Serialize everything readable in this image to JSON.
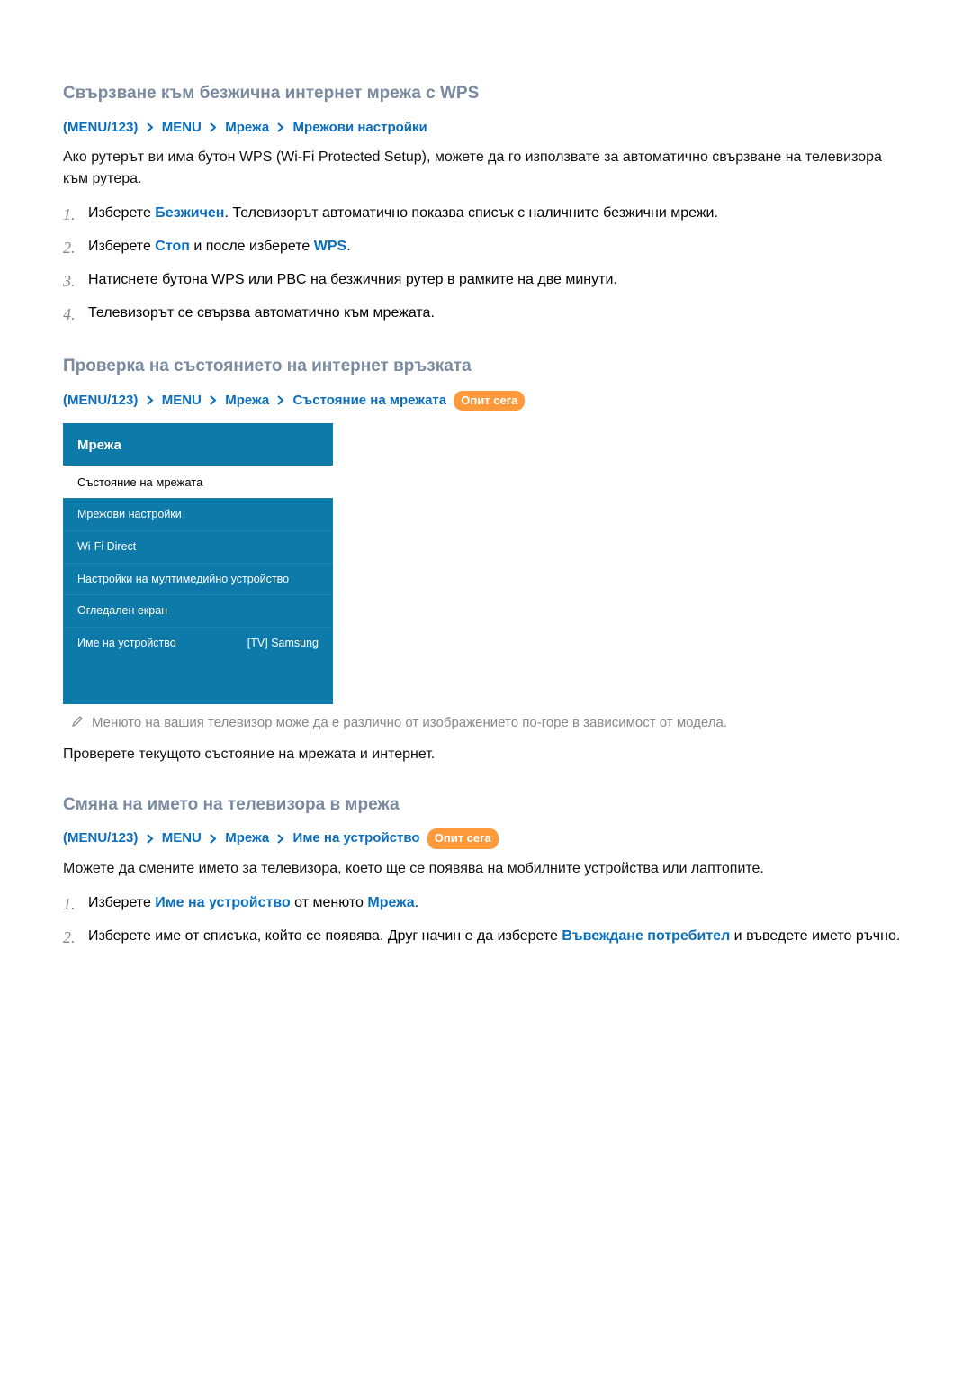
{
  "section1": {
    "title": "Свързване към безжична интернет мрежа с WPS",
    "breadcrumb": {
      "paren_open": "(",
      "p1": "MENU/123",
      "paren_close": ")",
      "p2": "MENU",
      "p3": "Мрежа",
      "p4": "Мрежови настройки"
    },
    "intro": "Ако рутерът ви има бутон WPS (Wi-Fi Protected Setup), можете да го използвате за автоматично свързване на телевизора към рутера.",
    "steps": [
      {
        "num": "1.",
        "pre": "Изберете ",
        "kw1": "Безжичен",
        "post1": ". Телевизорът автоматично показва списък с наличните безжични мрежи."
      },
      {
        "num": "2.",
        "pre": "Изберете ",
        "kw1": "Стоп",
        "mid": " и после изберете ",
        "kw2": "WPS",
        "post": "."
      },
      {
        "num": "3.",
        "text": "Натиснете бутона WPS или PBC на безжичния рутер в рамките на две минути."
      },
      {
        "num": "4.",
        "text": "Телевизорът се свързва автоматично към мрежата."
      }
    ]
  },
  "section2": {
    "title": "Проверка на състоянието на интернет връзката",
    "breadcrumb": {
      "paren_open": "(",
      "p1": "MENU/123",
      "paren_close": ")",
      "p2": "MENU",
      "p3": "Мрежа",
      "p4": "Състояние на мрежата",
      "badge": "Опит сега"
    },
    "menu": {
      "title": "Мрежа",
      "items": [
        {
          "label": "Състояние на мрежата",
          "selected": true
        },
        {
          "label": "Мрежови настройки"
        },
        {
          "label": "Wi-Fi Direct"
        },
        {
          "label": "Настройки на мултимедийно устройство"
        },
        {
          "label": "Огледален екран"
        },
        {
          "label": "Име на устройство",
          "value": "[TV] Samsung"
        }
      ]
    },
    "note": "Менюто на вашия телевизор може да е различно от изображението по-горе в зависимост от модела.",
    "outro": "Проверете текущото състояние на мрежата и интернет."
  },
  "section3": {
    "title": "Смяна на името на телевизора в мрежа",
    "breadcrumb": {
      "paren_open": "(",
      "p1": "MENU/123",
      "paren_close": ")",
      "p2": "MENU",
      "p3": "Мрежа",
      "p4": "Име на устройство",
      "badge": "Опит сега"
    },
    "intro": "Можете да смените името за телевизора, което ще се появява на мобилните устройства или лаптопите.",
    "steps": [
      {
        "num": "1.",
        "pre": "Изберете ",
        "kw1": "Име на устройство",
        "mid": " от менюто ",
        "kw2": "Мрежа",
        "post": "."
      },
      {
        "num": "2.",
        "pre": "Изберете име от списъка, който се появява. Друг начин е да изберете ",
        "kw1": "Въвеждане потребител",
        "post": " и въведете името ръчно."
      }
    ]
  }
}
